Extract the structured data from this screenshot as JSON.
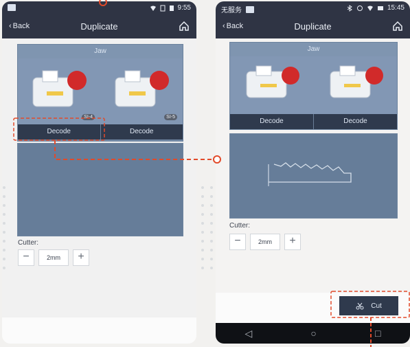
{
  "phone1": {
    "statusbar": {
      "time": "9:55"
    },
    "navbar": {
      "back_label": "Back",
      "title": "Duplicate"
    },
    "jaw": {
      "title": "Jaw",
      "items": [
        {
          "badge": "SI-4",
          "decode_label": "Decode"
        },
        {
          "badge": "SI-5",
          "decode_label": "Decode"
        }
      ]
    },
    "cutter": {
      "label": "Cutter:",
      "value": "2mm",
      "minus": "−",
      "plus": "+"
    }
  },
  "phone2": {
    "statusbar": {
      "carrier": "无服务",
      "time": "15:45"
    },
    "navbar": {
      "back_label": "Back",
      "title": "Duplicate"
    },
    "jaw": {
      "title": "Jaw",
      "items": [
        {
          "decode_label": "Decode"
        },
        {
          "decode_label": "Decode"
        }
      ]
    },
    "cutter": {
      "label": "Cutter:",
      "value": "2mm",
      "minus": "−",
      "plus": "+"
    },
    "cut_button": {
      "label": "Cut"
    }
  }
}
